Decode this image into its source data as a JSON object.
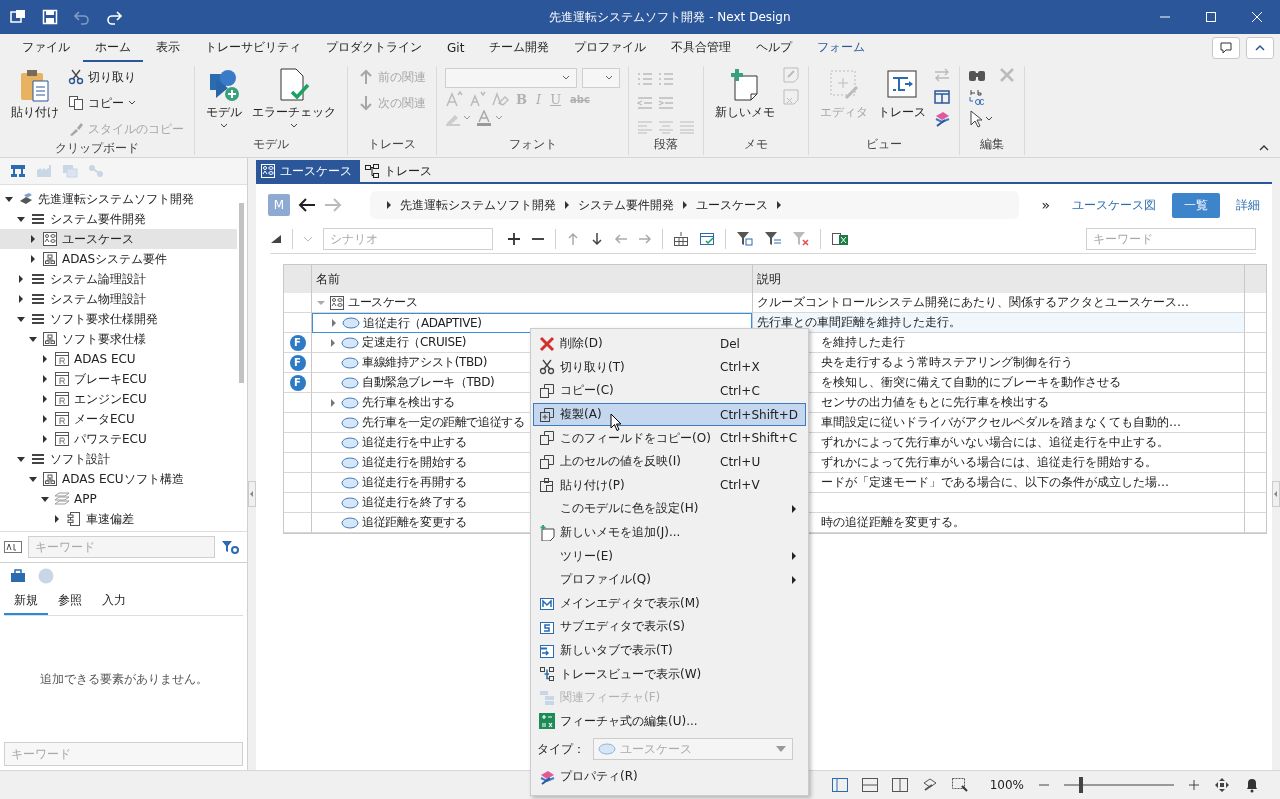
{
  "window": {
    "title": "先進運転システムソフト開発 - Next Design"
  },
  "ribbon_tabs": [
    {
      "label": "ファイル",
      "selected": false,
      "kind": "normal"
    },
    {
      "label": "ホーム",
      "selected": true,
      "kind": "normal"
    },
    {
      "label": "表示",
      "selected": false,
      "kind": "normal"
    },
    {
      "label": "トレーサビリティ",
      "selected": false,
      "kind": "normal"
    },
    {
      "label": "プロダクトライン",
      "selected": false,
      "kind": "normal"
    },
    {
      "label": "Git",
      "selected": false,
      "kind": "normal"
    },
    {
      "label": "チーム開発",
      "selected": false,
      "kind": "normal"
    },
    {
      "label": "プロファイル",
      "selected": false,
      "kind": "normal"
    },
    {
      "label": "不具合管理",
      "selected": false,
      "kind": "normal"
    },
    {
      "label": "ヘルプ",
      "selected": false,
      "kind": "normal"
    },
    {
      "label": "フォーム",
      "selected": false,
      "kind": "contextual"
    }
  ],
  "ribbon": {
    "clipboard": {
      "label": "クリップボード",
      "paste": {
        "label": "貼り付け",
        "disabled": false
      },
      "cut": {
        "label": "切り取り",
        "disabled": false
      },
      "copy": {
        "label": "コピー",
        "disabled": false
      },
      "copy_style": {
        "label": "スタイルのコピー",
        "disabled": true
      }
    },
    "model": {
      "label": "モデル",
      "model": {
        "label": "モデル"
      },
      "error_check": {
        "label": "エラーチェック"
      }
    },
    "trace": {
      "label": "トレース",
      "prev": {
        "label": "前の関連",
        "disabled": true
      },
      "next": {
        "label": "次の関連",
        "disabled": true
      }
    },
    "font": {
      "label": "フォント",
      "format_buttons": [
        "B",
        "I",
        "U",
        "abc"
      ]
    },
    "paragraph": {
      "label": "段落"
    },
    "memo": {
      "label": "メモ",
      "new_memo": {
        "label": "新しいメモ"
      }
    },
    "view": {
      "label": "ビュー",
      "editor": {
        "label": "エディタ",
        "disabled": true
      },
      "trace": {
        "label": "トレース",
        "disabled": false
      }
    },
    "edit": {
      "label": "編集"
    }
  },
  "left_panel": {
    "tree": [
      {
        "label": "先進運転システムソフト開発",
        "kind": "project",
        "expanded": true,
        "selected": false,
        "children": [
          {
            "label": "システム要件開発",
            "kind": "section",
            "expanded": true,
            "selected": false,
            "children": [
              {
                "label": "ユースケース",
                "kind": "usecase",
                "expanded": false,
                "selected": true
              },
              {
                "label": "ADASシステム要件",
                "kind": "diagram",
                "expanded": false,
                "selected": false
              }
            ]
          },
          {
            "label": "システム論理設計",
            "kind": "section",
            "expanded": false,
            "selected": false
          },
          {
            "label": "システム物理設計",
            "kind": "section",
            "expanded": false,
            "selected": false
          },
          {
            "label": "ソフト要求仕様開発",
            "kind": "section",
            "expanded": true,
            "selected": false,
            "children": [
              {
                "label": "ソフト要求仕様",
                "kind": "diagram",
                "expanded": true,
                "selected": false,
                "children": [
                  {
                    "label": "ADAS ECU",
                    "kind": "requirement",
                    "expanded": false,
                    "selected": false
                  },
                  {
                    "label": "ブレーキECU",
                    "kind": "requirement",
                    "expanded": false,
                    "selected": false
                  },
                  {
                    "label": "エンジンECU",
                    "kind": "requirement",
                    "expanded": false,
                    "selected": false
                  },
                  {
                    "label": "メータECU",
                    "kind": "requirement",
                    "expanded": false,
                    "selected": false
                  },
                  {
                    "label": "パワステECU",
                    "kind": "requirement",
                    "expanded": false,
                    "selected": false
                  }
                ]
              }
            ]
          },
          {
            "label": "ソフト設計",
            "kind": "section",
            "expanded": true,
            "selected": false,
            "children": [
              {
                "label": "ADAS ECUソフト構造",
                "kind": "structure",
                "expanded": true,
                "selected": false,
                "children": [
                  {
                    "label": "APP",
                    "kind": "layer",
                    "expanded": true,
                    "selected": false,
                    "children": [
                      {
                        "label": "車速偏差",
                        "kind": "component",
                        "expanded": false,
                        "selected": false
                      }
                    ]
                  }
                ]
              }
            ]
          }
        ]
      }
    ],
    "tree_search": {
      "placeholder": "キーワード"
    },
    "toolbox_tabs": [
      {
        "label": "新規",
        "selected": true
      },
      {
        "label": "参照",
        "selected": false
      },
      {
        "label": "入力",
        "selected": false
      }
    ],
    "toolbox_message": "追加できる要素がありません。",
    "toolbox_search": {
      "placeholder": "キーワード"
    }
  },
  "editor_tabs": [
    {
      "label": "ユースケース",
      "selected": true,
      "kind": "usecase"
    },
    {
      "label": "トレース",
      "selected": false,
      "kind": "trace"
    }
  ],
  "breadcrumb": {
    "avatar": "M",
    "items": [
      "先進運転システムソフト開発",
      "システム要件開発",
      "ユースケース"
    ],
    "more": "»"
  },
  "views": [
    {
      "label": "ユースケース図",
      "selected": false
    },
    {
      "label": "一覧",
      "selected": true
    },
    {
      "label": "詳細",
      "selected": false
    }
  ],
  "toolbar": {
    "scenario": {
      "placeholder": "シナリオ"
    },
    "keyword": {
      "placeholder": "キーワード"
    }
  },
  "table": {
    "columns": [
      "名前",
      "説明"
    ],
    "rows": [
      {
        "name": "ユースケース",
        "kind": "root",
        "expandable": true,
        "expanded": true,
        "selected": false,
        "description": "クルーズコントロールシステム開発にあたり、関係するアクタとユースケース…"
      },
      {
        "name": "追従走行（ADAPTIVE)",
        "kind": "usecase",
        "expandable": true,
        "expanded": false,
        "selected": true,
        "description": "先行車との車間距離を維持した走行。"
      },
      {
        "name": "定速走行（CRUISE)",
        "kind": "usecase",
        "expandable": true,
        "expanded": false,
        "selected": false,
        "badge": "F",
        "description": "を維持した走行"
      },
      {
        "name": "車線維持アシスト(TBD)",
        "kind": "usecase",
        "expandable": false,
        "selected": false,
        "badge": "F",
        "description": "央を走行するよう常時ステアリング制御を行う"
      },
      {
        "name": "自動緊急ブレーキ（TBD)",
        "kind": "usecase",
        "expandable": false,
        "selected": false,
        "badge": "F",
        "description": "を検知し、衝突に備えて自動的にブレーキを動作させる"
      },
      {
        "name": "先行車を検出する",
        "kind": "usecase",
        "expandable": true,
        "expanded": false,
        "selected": false,
        "description": "センサの出力値をもとに先行車を検出する"
      },
      {
        "name": "先行車を一定の距離で追従する",
        "kind": "usecase",
        "expandable": false,
        "selected": false,
        "description": "車間設定に従いドライバがアクセルペダルを踏まなくても自動的…"
      },
      {
        "name": "追従走行を中止する",
        "kind": "usecase",
        "expandable": false,
        "selected": false,
        "description": "ずれかによって先行車がいない場合には、追従走行を中止する。"
      },
      {
        "name": "追従走行を開始する",
        "kind": "usecase",
        "expandable": false,
        "selected": false,
        "description": "ずれかによって先行車がいる場合には、追従走行を開始する。"
      },
      {
        "name": "追従走行を再開する",
        "kind": "usecase",
        "expandable": false,
        "selected": false,
        "description": "ードが「定速モード」である場合に、以下の条件が成立した場…"
      },
      {
        "name": "追従走行を終了する",
        "kind": "usecase",
        "expandable": false,
        "selected": false
      },
      {
        "name": "追従距離を変更する",
        "kind": "usecase",
        "expandable": false,
        "selected": false,
        "description": "時の追従距離を変更する。"
      }
    ]
  },
  "context_menu": {
    "items": [
      {
        "label": "削除(D)",
        "shortcut": "Del",
        "kind": "command",
        "selected": false,
        "disabled": false
      },
      {
        "label": "切り取り(T)",
        "shortcut": "Ctrl+X",
        "kind": "command",
        "selected": false,
        "disabled": false
      },
      {
        "label": "コピー(C)",
        "shortcut": "Ctrl+C",
        "kind": "command",
        "selected": false,
        "disabled": false
      },
      {
        "label": "複製(A)",
        "shortcut": "Ctrl+Shift+D",
        "kind": "command",
        "selected": true,
        "disabled": false
      },
      {
        "label": "このフィールドをコピー(O)",
        "shortcut": "Ctrl+Shift+C",
        "kind": "command",
        "selected": false,
        "disabled": false
      },
      {
        "label": "上のセルの値を反映(I)",
        "shortcut": "Ctrl+U",
        "kind": "command",
        "selected": false,
        "disabled": false
      },
      {
        "label": "貼り付け(P)",
        "shortcut": "Ctrl+V",
        "kind": "command",
        "selected": false,
        "disabled": false
      },
      {
        "label": "このモデルに色を設定(H)",
        "kind": "submenu",
        "selected": false,
        "disabled": false
      },
      {
        "label": "新しいメモを追加(J)...",
        "kind": "command",
        "selected": false,
        "disabled": false
      },
      {
        "label": "ツリー(E)",
        "kind": "submenu",
        "selected": false,
        "disabled": false
      },
      {
        "label": "プロファイル(Q)",
        "kind": "submenu",
        "selected": false,
        "disabled": false
      },
      {
        "label": "メインエディタで表示(M)",
        "kind": "command",
        "selected": false,
        "disabled": false
      },
      {
        "label": "サブエディタで表示(S)",
        "kind": "command",
        "selected": false,
        "disabled": false
      },
      {
        "label": "新しいタブで表示(T)",
        "kind": "command",
        "selected": false,
        "disabled": false
      },
      {
        "label": "トレースビューで表示(W)",
        "kind": "command",
        "selected": false,
        "disabled": false
      },
      {
        "label": "関連フィーチャ(F)",
        "kind": "command",
        "selected": false,
        "disabled": true
      },
      {
        "label": "フィーチャ式の編集(U)...",
        "kind": "command",
        "selected": false,
        "disabled": false
      }
    ],
    "type": {
      "label": "タイプ：",
      "value": "ユースケース",
      "disabled": true
    },
    "properties": {
      "label": "プロパティ(R)"
    }
  },
  "status_bar": {
    "zoom": "100%",
    "level": 0.15
  }
}
